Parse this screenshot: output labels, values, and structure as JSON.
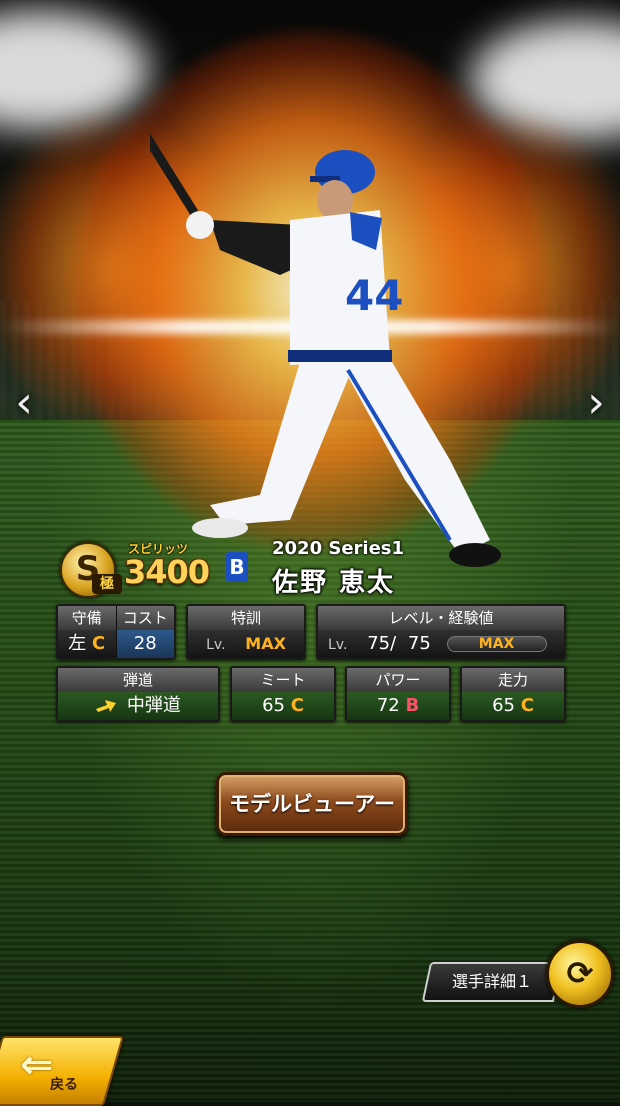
{
  "card": {
    "rank": "S",
    "rank_sub": "極",
    "spirits_label": "スピリッツ",
    "spirits_value": "3400",
    "team_logo": "B",
    "series": "2020 Series1",
    "player_name": "佐野 恵太"
  },
  "stats": {
    "fielding": {
      "label": "守備",
      "hand": "左",
      "grade": "C"
    },
    "cost": {
      "label": "コスト",
      "value": "28"
    },
    "training": {
      "label": "特訓",
      "lv": "Lv.",
      "value": "MAX"
    },
    "level": {
      "label": "レベル・経験値",
      "lv": "Lv.",
      "current": "75",
      "sep": "/",
      "max": "75",
      "exp_label": "MAX",
      "exp_fraction": 1.0
    },
    "trajectory": {
      "label": "弾道",
      "value": "中弾道"
    },
    "contact": {
      "label": "ミート",
      "value": "65",
      "grade": "C"
    },
    "power": {
      "label": "パワー",
      "value": "72",
      "grade": "B"
    },
    "speed": {
      "label": "走力",
      "value": "65",
      "grade": "C"
    }
  },
  "buttons": {
    "model_viewer": "モデルビューアー",
    "detail_tab": "選手詳細１",
    "back": "戻る"
  },
  "icons": {
    "nav_left": "chevron-left-icon",
    "nav_right": "chevron-right-icon",
    "swap": "swap-icon",
    "trajectory": "arrow-up-right-icon",
    "back": "back-arrow-icon"
  },
  "colors": {
    "grade_c": "#ffb21d",
    "grade_b": "#ff4f6a",
    "button_brown": "#8c4a1c",
    "back_yellow": "#f4b000"
  }
}
